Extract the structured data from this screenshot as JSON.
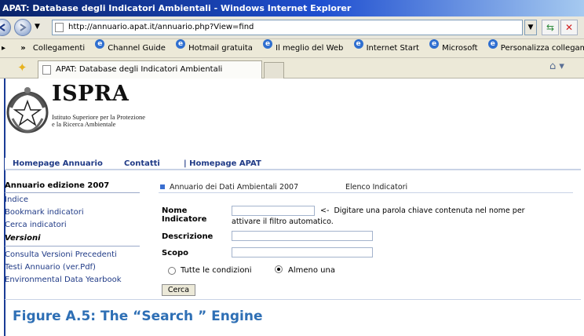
{
  "window": {
    "title": "APAT: Database degli Indicatori Ambientali - Windows Internet Explorer"
  },
  "address": {
    "url": "http://annuario.apat.it/annuario.php?View=find"
  },
  "links_bar": {
    "chevron": "»",
    "label": "Collegamenti",
    "items": [
      "Channel Guide",
      "Hotmail gratuita",
      "Il meglio del Web",
      "Internet Start",
      "Microsoft",
      "Personalizza collegamenti"
    ]
  },
  "tab": {
    "title": "APAT: Database degli Indicatori Ambientali"
  },
  "header": {
    "logo_text": "ISPRA",
    "subtitle_line1": "Istituto Superiore per la Protezione",
    "subtitle_line2": "e la Ricerca Ambientale"
  },
  "menu": {
    "homepage_annuario": "Homepage Annuario",
    "contatti": "Contatti",
    "homepage_apat": "| Homepage APAT"
  },
  "sidebar": {
    "heading": "Annuario edizione 2007",
    "links": [
      "Indice",
      "Bookmark indicatori",
      "Cerca indicatori"
    ],
    "versions_heading": "Versioni",
    "version_links": [
      "Consulta Versioni Precedenti",
      "Testi Annuario (ver.Pdf)",
      "Environmental Data Yearbook"
    ]
  },
  "breadcrumb": {
    "annuario": "Annuario dei Dati Ambientali 2007",
    "elenco": "Elenco Indicatori"
  },
  "form": {
    "nome_label_1": "Nome",
    "nome_label_2": "Indicatore",
    "nome_value": "",
    "hint_arrow": "<-",
    "hint_line1": "Digitare una parola chiave contenuta nel nome per",
    "hint_line2": "attivare il filtro automatico.",
    "descrizione_label": "Descrizione",
    "descrizione_value": "",
    "scopo_label": "Scopo",
    "scopo_value": "",
    "radio_all": "Tutte le condizioni",
    "radio_any": "Almeno una",
    "selected_radio": "Almeno una",
    "submit": "Cerca"
  },
  "caption": "Figure A.5: The “Search ” Engine",
  "colors": {
    "title_bar": "#0a246a",
    "link_blue": "#1f3a86",
    "caption_blue": "#2e6fb5",
    "rule_blue": "#1a3c96"
  }
}
